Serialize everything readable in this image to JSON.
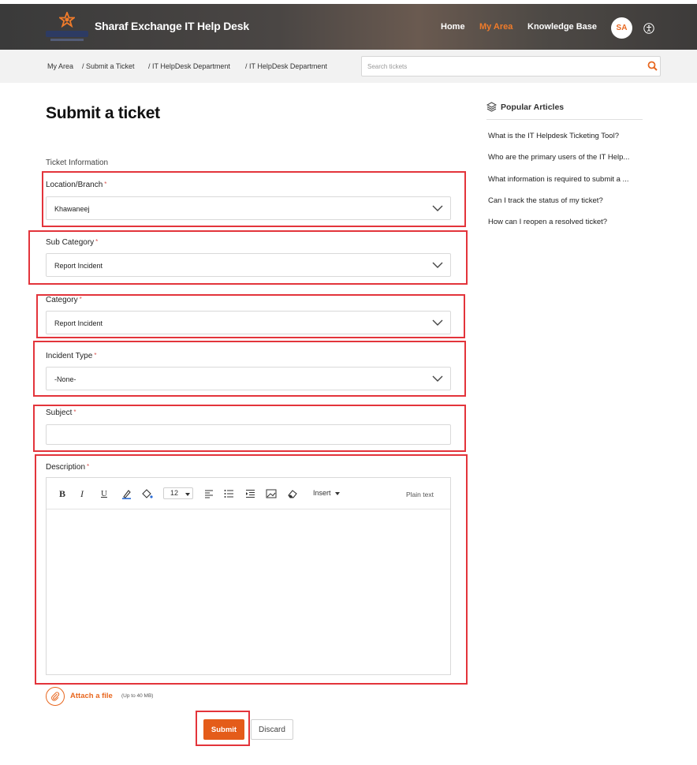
{
  "header": {
    "app_title": "Sharaf Exchange IT Help Desk",
    "nav": {
      "home": "Home",
      "my_area": "My Area",
      "knowledge_base": "Knowledge Base"
    },
    "avatar_initials": "SA",
    "accent_color": "#f07b2a"
  },
  "breadcrumb": {
    "items": [
      "My Area",
      "/ Submit a Ticket",
      "/ IT HelpDesk Department",
      "/ IT HelpDesk Department"
    ]
  },
  "search": {
    "placeholder": "Search tickets",
    "value": ""
  },
  "page": {
    "title": "Submit a ticket",
    "section_label": "Ticket Information"
  },
  "form": {
    "required_marker": "*",
    "location": {
      "label": "Location/Branch",
      "value": "Khawaneej"
    },
    "sub_category": {
      "label": "Sub Category",
      "value": "Report Incident"
    },
    "category": {
      "label": "Category",
      "value": "Report Incident"
    },
    "incident_type": {
      "label": "Incident Type",
      "value": "-None-"
    },
    "subject": {
      "label": "Subject",
      "value": ""
    },
    "description": {
      "label": "Description",
      "font_size": "12",
      "insert_label": "Insert",
      "plain_text_label": "Plain text",
      "toolbar_icons": [
        "bold-icon",
        "italic-icon",
        "underline-icon",
        "text-color-icon",
        "fill-color-icon",
        "align-left-icon",
        "bullet-list-icon",
        "indent-icon",
        "image-icon",
        "eraser-icon"
      ]
    },
    "attach": {
      "label": "Attach a file",
      "hint": "(Up to 40 MB)"
    },
    "submit_label": "Submit",
    "discard_label": "Discard"
  },
  "sidebar": {
    "title": "Popular Articles",
    "articles": [
      "What is the IT Helpdesk Ticketing Tool?",
      "Who are the primary users of the IT Help...",
      "What information is required to submit a ...",
      "Can I track the status of my ticket?",
      "How can I reopen a resolved ticket?"
    ]
  }
}
